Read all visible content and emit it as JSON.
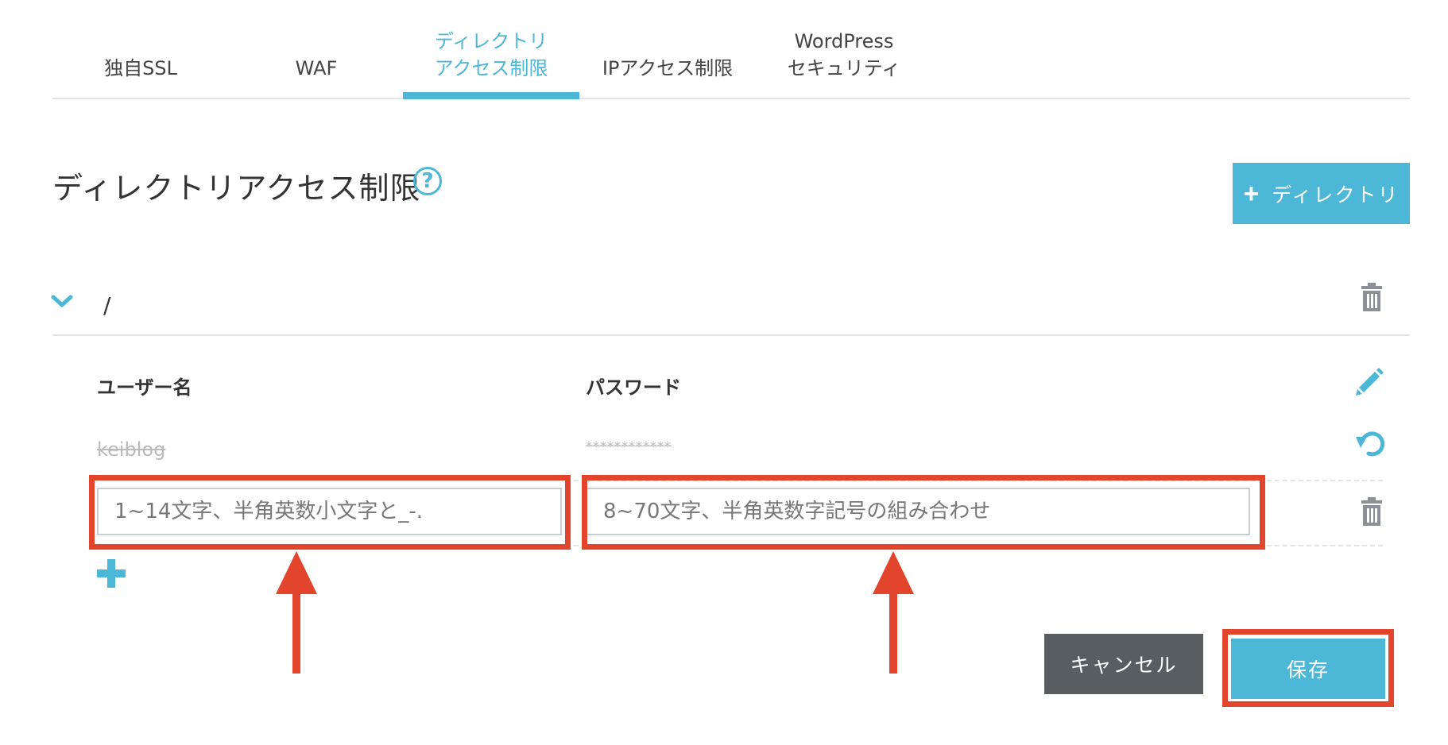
{
  "tabs": [
    {
      "line1": "",
      "line2": "独自SSL",
      "active": false
    },
    {
      "line1": "",
      "line2": "WAF",
      "active": false
    },
    {
      "line1": "ディレクトリ",
      "line2": "アクセス制限",
      "active": true
    },
    {
      "line1": "",
      "line2": "IPアクセス制限",
      "active": false
    },
    {
      "line1": "WordPress",
      "line2": "セキュリティ",
      "active": false
    }
  ],
  "section": {
    "title": "ディレクトリアクセス制限",
    "help_symbol": "?",
    "add_directory_label": "ディレクトリ",
    "add_symbol": "+"
  },
  "directory": {
    "path": "/",
    "columns": {
      "username": "ユーザー名",
      "password": "パスワード"
    },
    "existing_user": {
      "username": "keiblog",
      "password": "************"
    },
    "new_user": {
      "username_placeholder": "1~14文字、半角英数小文字と_-.",
      "password_placeholder": "8~70文字、半角英数字記号の組み合わせ"
    }
  },
  "actions": {
    "cancel_label": "キャンセル",
    "save_label": "保存"
  },
  "colors": {
    "accent": "#4db7d8",
    "highlight": "#e2452c",
    "cancel": "#585d61"
  },
  "icons": [
    "help-icon",
    "plus-icon",
    "chevron-down-icon",
    "trash-icon",
    "pencil-icon",
    "undo-icon",
    "arrow-up-icon"
  ]
}
